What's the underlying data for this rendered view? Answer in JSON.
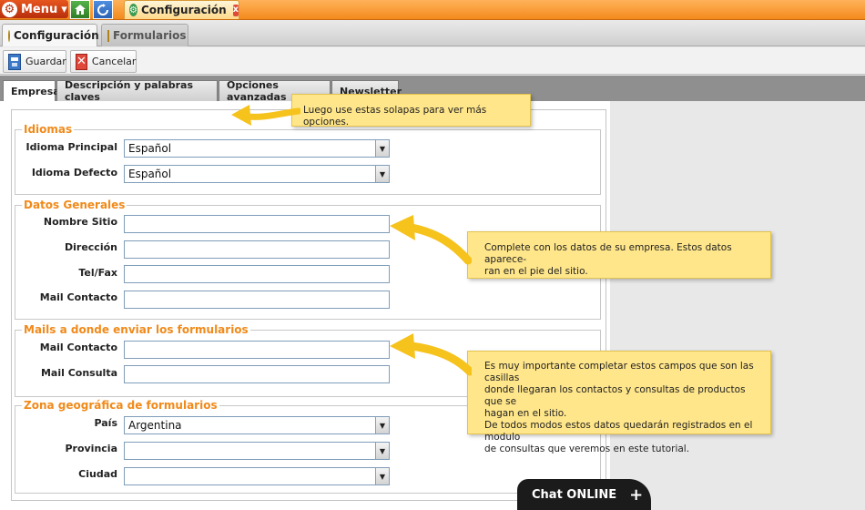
{
  "topbar": {
    "menu_label": "Menu",
    "menu_caret": "▾",
    "window_tab_title": "Configuración",
    "close_glyph": "x"
  },
  "module_tabs": [
    {
      "label": "Configuración",
      "active": true
    },
    {
      "label": "Formularios",
      "active": false
    }
  ],
  "toolbar": {
    "save_label": "Guardar",
    "cancel_label": "Cancelar"
  },
  "content_tabs": [
    {
      "label": "Empresa",
      "active": true
    },
    {
      "label": "Descripción y palabras claves",
      "active": false
    },
    {
      "label": "Opciones avanzadas",
      "active": false
    },
    {
      "label": "Newsletter",
      "active": false
    }
  ],
  "sections": {
    "idiomas": {
      "legend": "Idiomas",
      "principal_label": "Idioma Principal",
      "principal_value": "Español",
      "defecto_label": "Idioma Defecto",
      "defecto_value": "Español"
    },
    "datos": {
      "legend": "Datos Generales",
      "nombre_label": "Nombre Sitio",
      "direccion_label": "Dirección",
      "telfax_label": "Tel/Fax",
      "mail_label": "Mail Contacto",
      "nombre_value": "",
      "direccion_value": "",
      "telfax_value": "",
      "mail_value": ""
    },
    "mails": {
      "legend": "Mails a donde enviar los formularios",
      "contacto_label": "Mail Contacto",
      "consulta_label": "Mail Consulta",
      "contacto_value": "",
      "consulta_value": ""
    },
    "zona": {
      "legend": "Zona geográfica de formularios",
      "pais_label": "País",
      "pais_value": "Argentina",
      "provincia_label": "Provincia",
      "provincia_value": "",
      "ciudad_label": "Ciudad",
      "ciudad_value": ""
    }
  },
  "tooltips": {
    "tabs_tip": "Luego use estas solapas para ver más opciones.",
    "datos_tip_line1": "Complete con los datos de su empresa. Estos datos aparece-",
    "datos_tip_line2": "ran en el pie del sitio.",
    "mails_tip_line1": "Es muy importante completar estos campos que son las casillas",
    "mails_tip_line2": "donde llegaran los contactos y consultas de productos que se",
    "mails_tip_line3": "hagan en el sitio.",
    "mails_tip_line4": "De todos modos estos datos quedarán registrados en el modulo",
    "mails_tip_line5": "de consultas que veremos en este tutorial."
  },
  "chat": {
    "label": "Chat ONLINE",
    "plus": "+"
  },
  "colors": {
    "accent_orange": "#f08a1a",
    "tooltip_yellow": "#ffe68a",
    "arrow_yellow": "#f6c21c"
  }
}
